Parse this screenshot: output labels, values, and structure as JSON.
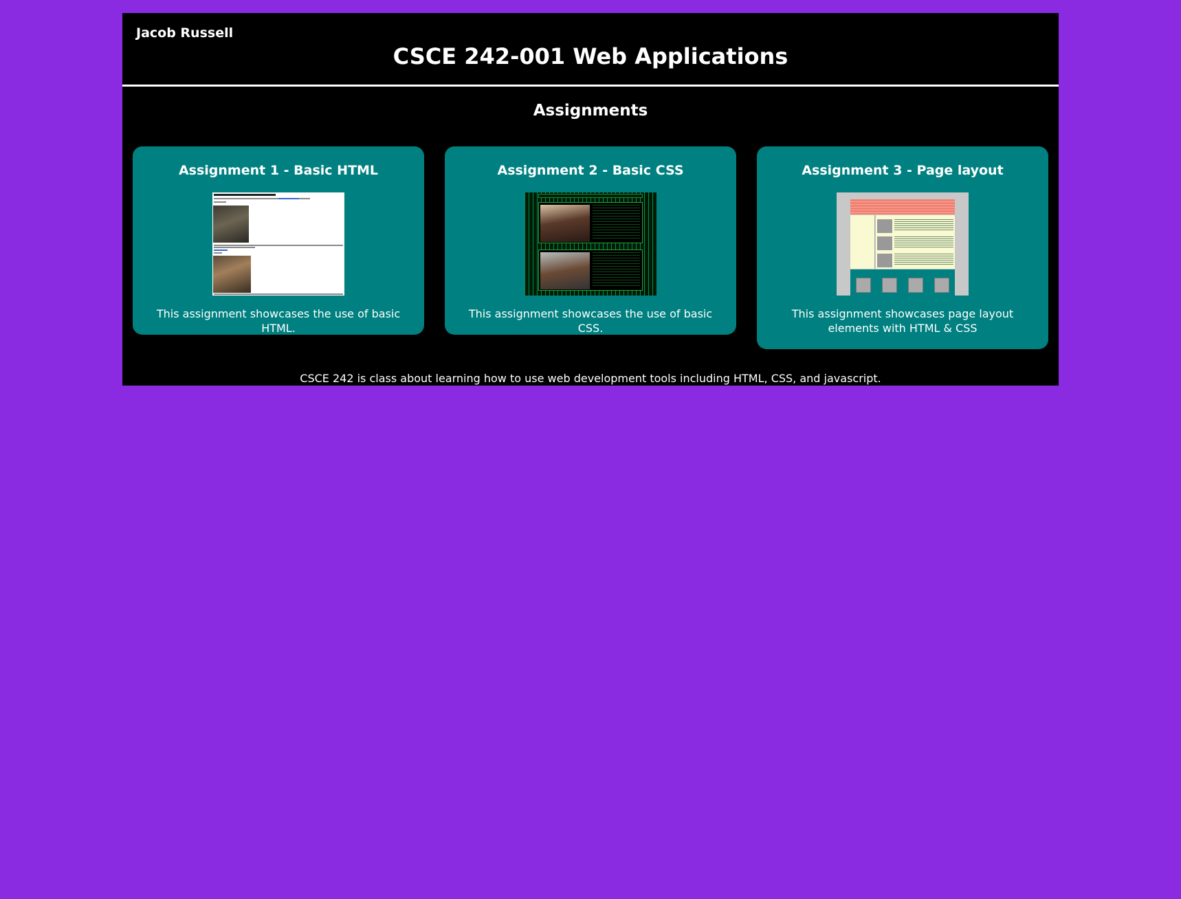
{
  "header": {
    "author": "Jacob Russell",
    "title": "CSCE 242-001 Web Applications"
  },
  "main": {
    "section_title": "Assignments",
    "cards": [
      {
        "title": "Assignment 1 - Basic HTML",
        "description": "This assignment showcases the use of basic HTML."
      },
      {
        "title": "Assignment 2 - Basic CSS",
        "description": "This assignment showcases the use of basic CSS."
      },
      {
        "title": "Assignment 3 - Page layout",
        "description": "This assignment showcases page layout elements with HTML & CSS"
      }
    ]
  },
  "footer": {
    "text": "CSCE 242 is class about learning how to use web development tools including HTML, CSS, and javascript."
  },
  "colors": {
    "background": "#8a2be2",
    "page": "#000000",
    "card": "#008080",
    "text": "#ffffff"
  }
}
